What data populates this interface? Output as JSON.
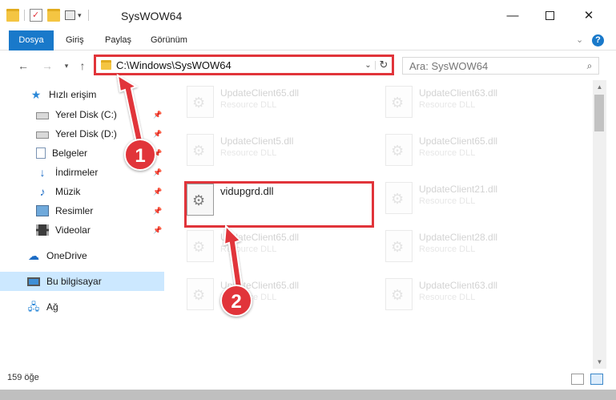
{
  "window": {
    "title": "SysWOW64",
    "minimize_icon": "minimize-icon",
    "maximize_icon": "maximize-icon",
    "close_icon": "close-icon"
  },
  "ribbon": {
    "tabs": [
      {
        "label": "Dosya",
        "active": true
      },
      {
        "label": "Giriş"
      },
      {
        "label": "Paylaş"
      },
      {
        "label": "Görünüm"
      }
    ],
    "help_glyph": "?"
  },
  "nav": {
    "address": "C:\\Windows\\SysWOW64",
    "search_placeholder": "Ara: SysWOW64"
  },
  "sidebar": {
    "items": [
      {
        "label": "Hızlı erişim",
        "icon": "star-icon"
      },
      {
        "label": "Yerel Disk (C:)",
        "icon": "disk-icon",
        "pinned": true
      },
      {
        "label": "Yerel Disk (D:)",
        "icon": "disk-icon",
        "pinned": true
      },
      {
        "label": "Belgeler",
        "icon": "documents-icon",
        "pinned": true
      },
      {
        "label": "İndirmeler",
        "icon": "downloads-icon",
        "pinned": true
      },
      {
        "label": "Müzik",
        "icon": "music-icon",
        "pinned": true
      },
      {
        "label": "Resimler",
        "icon": "pictures-icon",
        "pinned": true
      },
      {
        "label": "Videolar",
        "icon": "videos-icon",
        "pinned": true
      },
      {
        "label": "OneDrive",
        "icon": "cloud-icon"
      },
      {
        "label": "Bu bilgisayar",
        "icon": "computer-icon",
        "selected": true
      },
      {
        "label": "Ağ",
        "icon": "network-icon"
      }
    ]
  },
  "files": [
    {
      "name": "UpdateClient65.dll",
      "type": "Resource DLL"
    },
    {
      "name": "UpdateClient63.dll",
      "type": "Resource DLL"
    },
    {
      "name": "UpdateClient5.dll",
      "type": "Resource DLL"
    },
    {
      "name": "UpdateClient65.dll",
      "type": "Resource DLL"
    },
    {
      "name": "vidupgrd.dll",
      "type": ""
    },
    {
      "name": "UpdateClient21.dll",
      "type": "Resource DLL"
    },
    {
      "name": "UpdateClient65.dll",
      "type": "Resource DLL"
    },
    {
      "name": "UpdateClient28.dll",
      "type": "Resource DLL"
    },
    {
      "name": "UpdateClient65.dll",
      "type": "Resource DLL"
    },
    {
      "name": "UpdateClient63.dll",
      "type": "Resource DLL"
    }
  ],
  "status": {
    "item_count": "159 öğe"
  },
  "annotations": {
    "step1": "1",
    "step2": "2",
    "color": "#e1343a"
  }
}
